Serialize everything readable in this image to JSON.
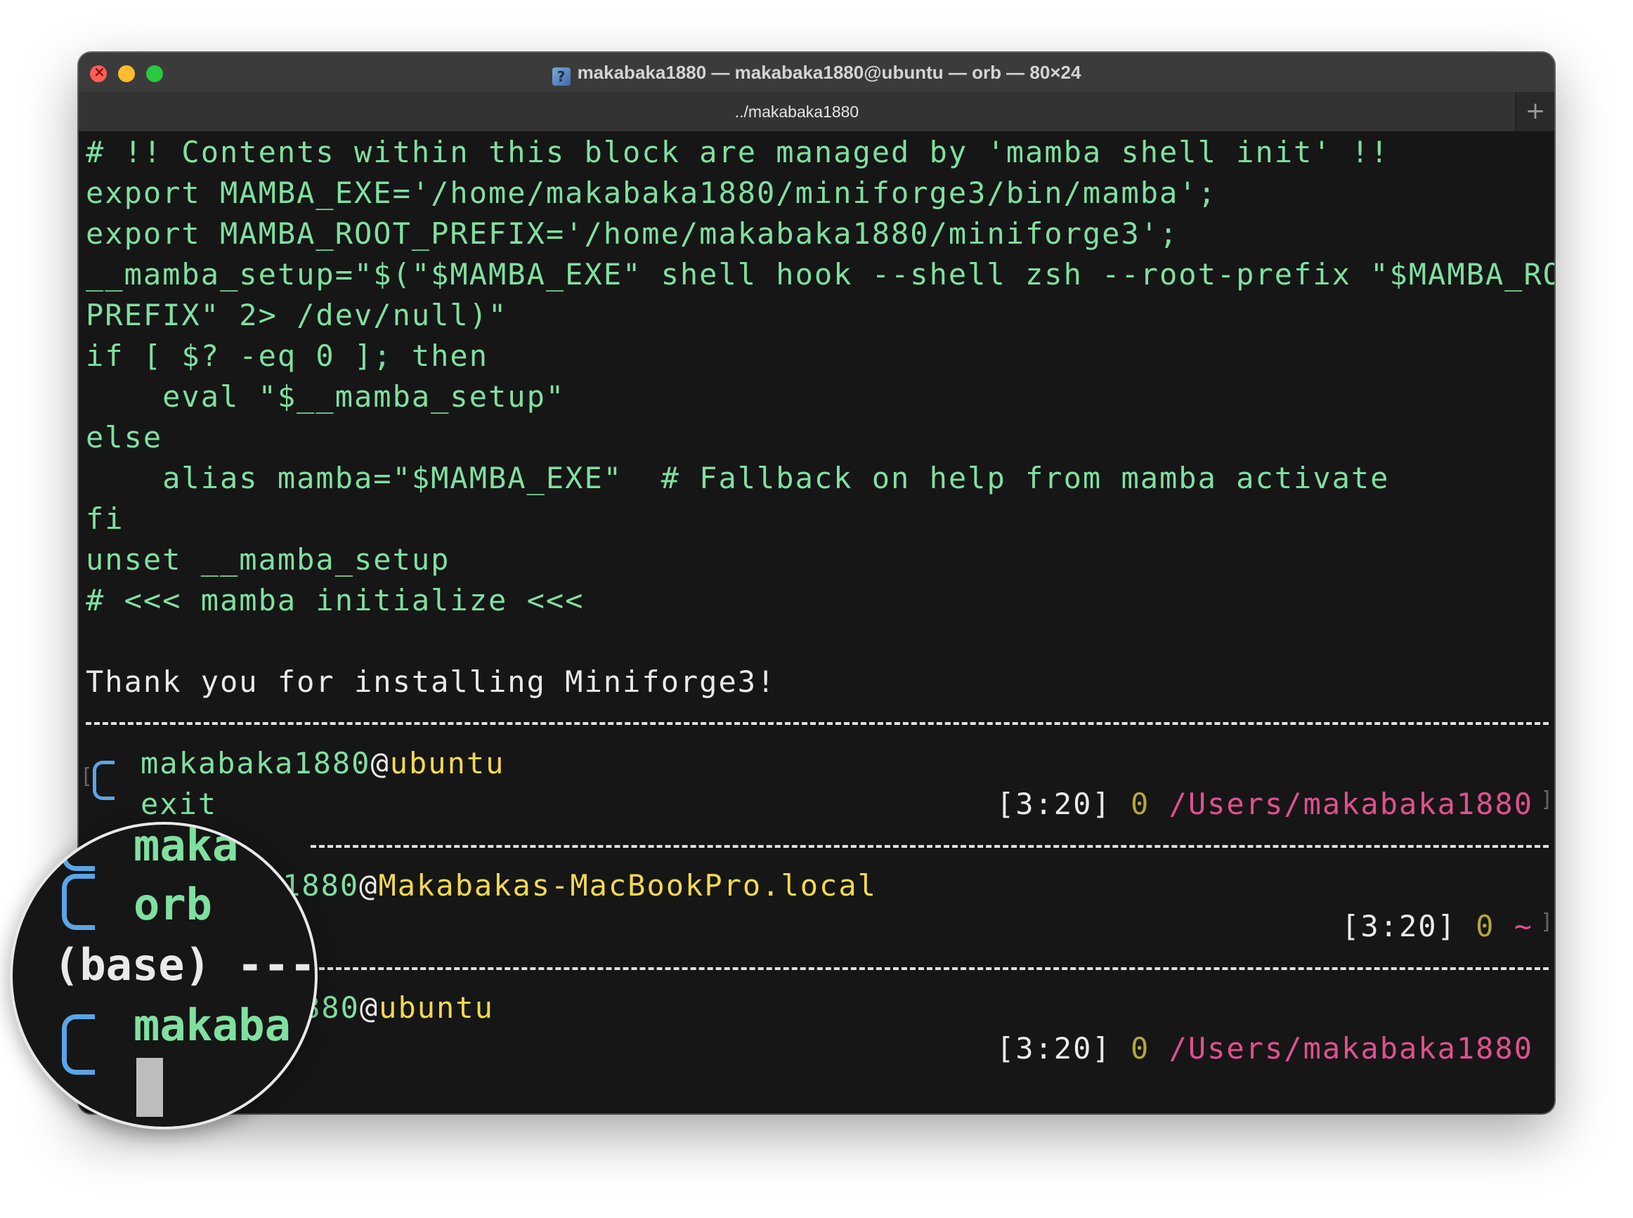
{
  "window": {
    "title": "makabaka1880 — makabaka1880@ubuntu — orb — 80×24",
    "title_icon": "?",
    "tab_label": "../makabaka1880",
    "add_tab_label": "+"
  },
  "terminal": {
    "lines": [
      "# !! Contents within this block are managed by 'mamba shell init' !!",
      "export MAMBA_EXE='/home/makabaka1880/miniforge3/bin/mamba';",
      "export MAMBA_ROOT_PREFIX='/home/makabaka1880/miniforge3';",
      "__mamba_setup=\"$(\"$MAMBA_EXE\" shell hook --shell zsh --root-prefix \"$MAMBA_ROOT_",
      "PREFIX\" 2> /dev/null)\"",
      "if [ $? -eq 0 ]; then",
      "    eval \"$__mamba_setup\"",
      "else",
      "    alias mamba=\"$MAMBA_EXE\"  # Fallback on help from mamba activate",
      "fi",
      "unset __mamba_setup",
      "# <<< mamba initialize <<<"
    ],
    "thanks": "Thank you for installing Miniforge3!",
    "prompt1": {
      "user": "makabaka1880",
      "at": "@",
      "host": "ubuntu",
      "command": "exit",
      "time": "[3:20]",
      "status": "0",
      "path": "/Users/makabaka1880"
    },
    "prompt2": {
      "user_tail": "1880",
      "at": "@",
      "host": "Makabakas-MacBookPro.local",
      "time": "[3:20]",
      "status": "0",
      "path": "~"
    },
    "prompt3": {
      "user_tail": "880",
      "at": "@",
      "host": "ubuntu",
      "time": "[3:20]",
      "status": "0",
      "path": "/Users/makabaka1880"
    }
  },
  "magnifier": {
    "line1": "maka",
    "line2": "orb",
    "line3": "(base) ---",
    "line4": "makaba"
  },
  "colors": {
    "code_green": "#7fe0a0",
    "host_yellow": "#f2d94e",
    "path_pink": "#e0508f",
    "bracket_blue": "#5aa5e6"
  }
}
